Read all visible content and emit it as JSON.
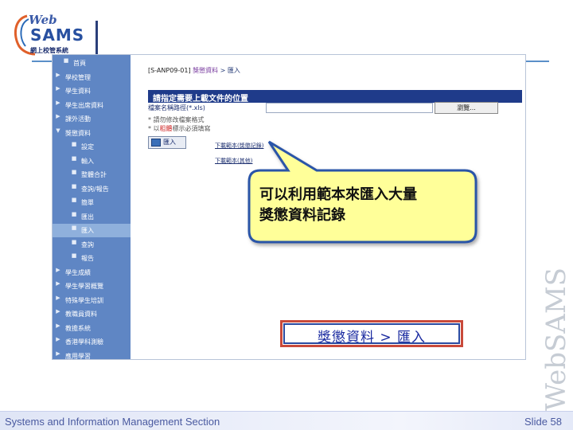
{
  "logo": {
    "web": "Web",
    "sams": "SAMS",
    "subtitle": "網上校管系統"
  },
  "sidebar": {
    "items": [
      {
        "label": "首頁",
        "marker": "■",
        "level": "top"
      },
      {
        "label": "學校管理",
        "marker": "▶",
        "level": "l1"
      },
      {
        "label": "學生資料",
        "marker": "▶",
        "level": "l1"
      },
      {
        "label": "學生出席資料",
        "marker": "▶",
        "level": "l1"
      },
      {
        "label": "課外活動",
        "marker": "▶",
        "level": "l1"
      },
      {
        "label": "獎懲資料",
        "marker": "▼",
        "level": "l1"
      },
      {
        "label": "設定",
        "marker": "■",
        "level": "l2"
      },
      {
        "label": "輸入",
        "marker": "■",
        "level": "l2"
      },
      {
        "label": "整體合計",
        "marker": "■",
        "level": "l2"
      },
      {
        "label": "查詢/報告",
        "marker": "■",
        "level": "l2"
      },
      {
        "label": "簡單",
        "marker": "■",
        "level": "l2"
      },
      {
        "label": "匯出",
        "marker": "■",
        "level": "l2"
      },
      {
        "label": "匯入",
        "marker": "■",
        "level": "l2",
        "active": true
      },
      {
        "label": "查詢",
        "marker": "■",
        "level": "l2"
      },
      {
        "label": "報告",
        "marker": "■",
        "level": "l2"
      },
      {
        "label": "學生成績",
        "marker": "▶",
        "level": "l1"
      },
      {
        "label": "學生學習概覽",
        "marker": "▶",
        "level": "l1"
      },
      {
        "label": "特殊學生培訓",
        "marker": "▶",
        "level": "l1"
      },
      {
        "label": "教職員資料",
        "marker": "▶",
        "level": "l1"
      },
      {
        "label": "教擔系統",
        "marker": "▶",
        "level": "l1"
      },
      {
        "label": "香港學科測驗",
        "marker": "▶",
        "level": "l1"
      },
      {
        "label": "應用學習",
        "marker": "▶",
        "level": "l1"
      }
    ]
  },
  "content": {
    "breadcrumb_code": "[S-ANP09-01]",
    "breadcrumb_module": "獎懲資料",
    "breadcrumb_sep": ">",
    "breadcrumb_page": "匯入",
    "panel_title": "請指定需要上載文件的位置",
    "path_label": "檔案名稱路徑(*.xls)",
    "browse_label": "瀏覽...",
    "note1": "* 請勿修改檔案格式",
    "note2_prefix": "* 以",
    "note2_red": "粗體",
    "note2_suffix": "標示必須填寫",
    "import_label": "匯入",
    "template_link1": "下載範本(獎懲記錄)",
    "template_link2": "下載範本(其他)"
  },
  "callout": {
    "line1": "可以利用範本來匯入大量",
    "line2": "獎懲資料記錄"
  },
  "banner": {
    "module": "獎懲資料",
    "sep": ">",
    "page": "匯入"
  },
  "watermark": {
    "text": "WebSAMS"
  },
  "footer": {
    "left": "Systems and Information Management Section",
    "right": "Slide 58"
  },
  "colors": {
    "sidebar": "#5f86c4",
    "panel_title": "#1f3b8a",
    "callout_fill": "#ffff99",
    "banner_border": "#c94a3a",
    "banner_text": "#1a2aa0"
  }
}
